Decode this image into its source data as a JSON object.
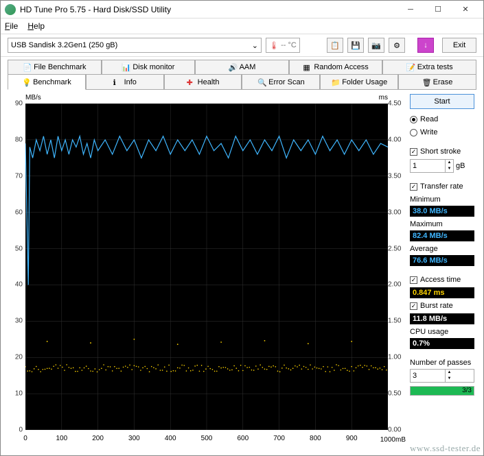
{
  "window": {
    "title": "HD Tune Pro 5.75 - Hard Disk/SSD Utility"
  },
  "menu": {
    "file": "File",
    "help": "Help"
  },
  "toolbar": {
    "drive": "USB Sandisk 3.2Gen1 (250 gB)",
    "temp": "-- °C",
    "exit": "Exit"
  },
  "tabs_row1": [
    {
      "label": "File Benchmark"
    },
    {
      "label": "Disk monitor"
    },
    {
      "label": "AAM"
    },
    {
      "label": "Random Access"
    },
    {
      "label": "Extra tests"
    }
  ],
  "tabs_row2": [
    {
      "label": "Benchmark",
      "active": true
    },
    {
      "label": "Info"
    },
    {
      "label": "Health"
    },
    {
      "label": "Error Scan"
    },
    {
      "label": "Folder Usage"
    },
    {
      "label": "Erase"
    }
  ],
  "sidebar": {
    "start": "Start",
    "read": "Read",
    "write": "Write",
    "short_stroke": "Short stroke",
    "short_stroke_val": "1",
    "short_stroke_unit": "gB",
    "transfer_rate": "Transfer rate",
    "min_label": "Minimum",
    "min_val": "38.0 MB/s",
    "max_label": "Maximum",
    "max_val": "82.4 MB/s",
    "avg_label": "Average",
    "avg_val": "76.6 MB/s",
    "access_label": "Access time",
    "access_val": "0.847 ms",
    "burst_label": "Burst rate",
    "burst_val": "11.8 MB/s",
    "cpu_label": "CPU usage",
    "cpu_val": "0.7%",
    "passes_label": "Number of passes",
    "passes_val": "3",
    "progress_text": "3/3"
  },
  "chart_data": {
    "type": "line",
    "left_axis": {
      "label": "MB/s",
      "min": 0,
      "max": 90,
      "ticks": [
        0,
        10,
        20,
        30,
        40,
        50,
        60,
        70,
        80,
        90
      ]
    },
    "right_axis": {
      "label": "ms",
      "min": 0,
      "max": 4.5,
      "ticks": [
        0.0,
        0.5,
        1.0,
        1.5,
        2.0,
        2.5,
        3.0,
        3.5,
        4.0,
        4.5
      ]
    },
    "x_axis": {
      "label": "1000mB",
      "min": 0,
      "max": 1000,
      "ticks": [
        0,
        100,
        200,
        300,
        400,
        500,
        600,
        700,
        800,
        900
      ]
    },
    "series": [
      {
        "name": "Transfer rate (MB/s)",
        "axis": "left",
        "color": "#3fb6ff",
        "x": [
          0,
          8,
          12,
          20,
          30,
          40,
          50,
          60,
          70,
          80,
          90,
          100,
          110,
          120,
          130,
          140,
          150,
          160,
          170,
          180,
          190,
          200,
          220,
          240,
          260,
          280,
          300,
          320,
          340,
          360,
          380,
          400,
          420,
          440,
          460,
          480,
          500,
          520,
          540,
          560,
          580,
          600,
          620,
          640,
          660,
          680,
          700,
          720,
          740,
          760,
          780,
          800,
          820,
          840,
          860,
          880,
          900,
          920,
          940,
          960,
          980,
          1000
        ],
        "values": [
          79,
          40,
          78,
          75,
          80,
          77,
          81,
          76,
          80,
          75,
          81,
          77,
          80,
          76,
          80,
          78,
          81,
          76,
          79,
          75,
          80,
          77,
          80,
          76,
          81,
          77,
          80,
          75,
          80,
          77,
          81,
          76,
          80,
          77,
          80,
          76,
          81,
          77,
          79,
          75,
          81,
          77,
          80,
          76,
          80,
          77,
          81,
          75,
          80,
          77,
          80,
          76,
          81,
          77,
          80,
          76,
          80,
          77,
          80,
          76,
          79,
          78
        ]
      },
      {
        "name": "Access time (ms)",
        "axis": "right",
        "color": "#ffd400",
        "scatter": true,
        "mean": 0.847,
        "band_low": 0.8,
        "band_high": 0.9,
        "outliers_y": [
          1.22,
          1.2,
          1.25,
          1.18,
          1.21,
          1.23,
          1.19,
          1.22
        ]
      }
    ]
  },
  "watermark": "www.ssd-tester.de"
}
